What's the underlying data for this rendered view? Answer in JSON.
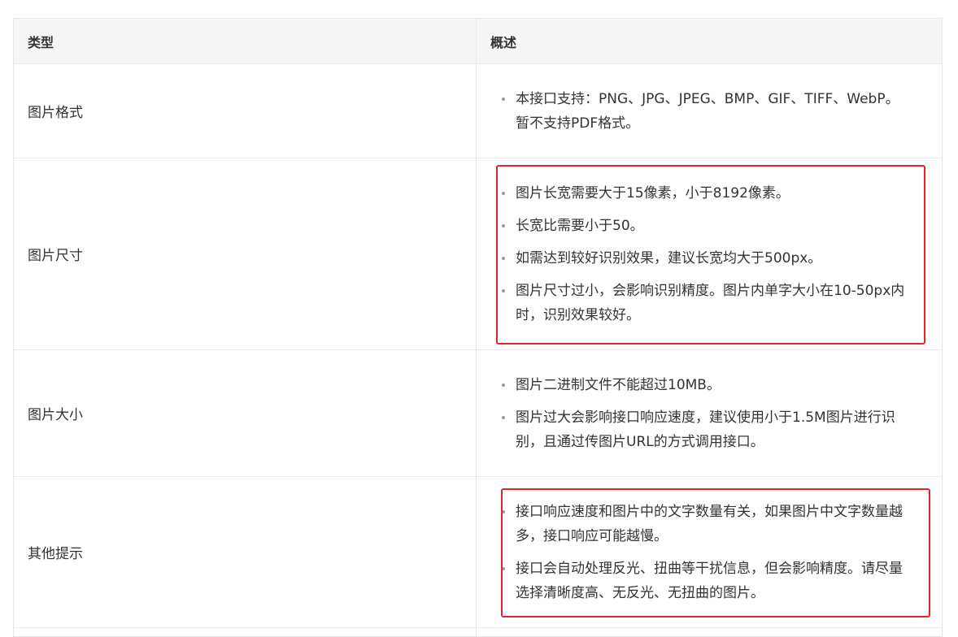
{
  "header": {
    "col_type": "类型",
    "col_desc": "概述"
  },
  "rows": [
    {
      "type": "图片格式",
      "items": [
        "本接口支持：PNG、JPG、JPEG、BMP、GIF、TIFF、WebP。暂不支持PDF格式。"
      ]
    },
    {
      "type": "图片尺寸",
      "items": [
        "图片长宽需要大于15像素，小于8192像素。",
        "长宽比需要小于50。",
        "如需达到较好识别效果，建议长宽均大于500px。",
        "图片尺寸过小，会影响识别精度。图片内单字大小在10-50px内时，识别效果较好。"
      ]
    },
    {
      "type": "图片大小",
      "items": [
        "图片二进制文件不能超过10MB。",
        "图片过大会影响接口响应速度，建议使用小于1.5M图片进行识别，且通过传图片URL的方式调用接口。"
      ]
    },
    {
      "type": "其他提示",
      "items": [
        "接口响应速度和图片中的文字数量有关，如果图片中文字数量越多，接口响应可能越慢。",
        "接口会自动处理反光、扭曲等干扰信息，但会影响精度。请尽量选择清晰度高、无反光、无扭曲的图片。"
      ]
    }
  ],
  "colors": {
    "highlight": "#e0262f",
    "header_bg": "#f5f5f5",
    "border": "#e8e8e8"
  }
}
